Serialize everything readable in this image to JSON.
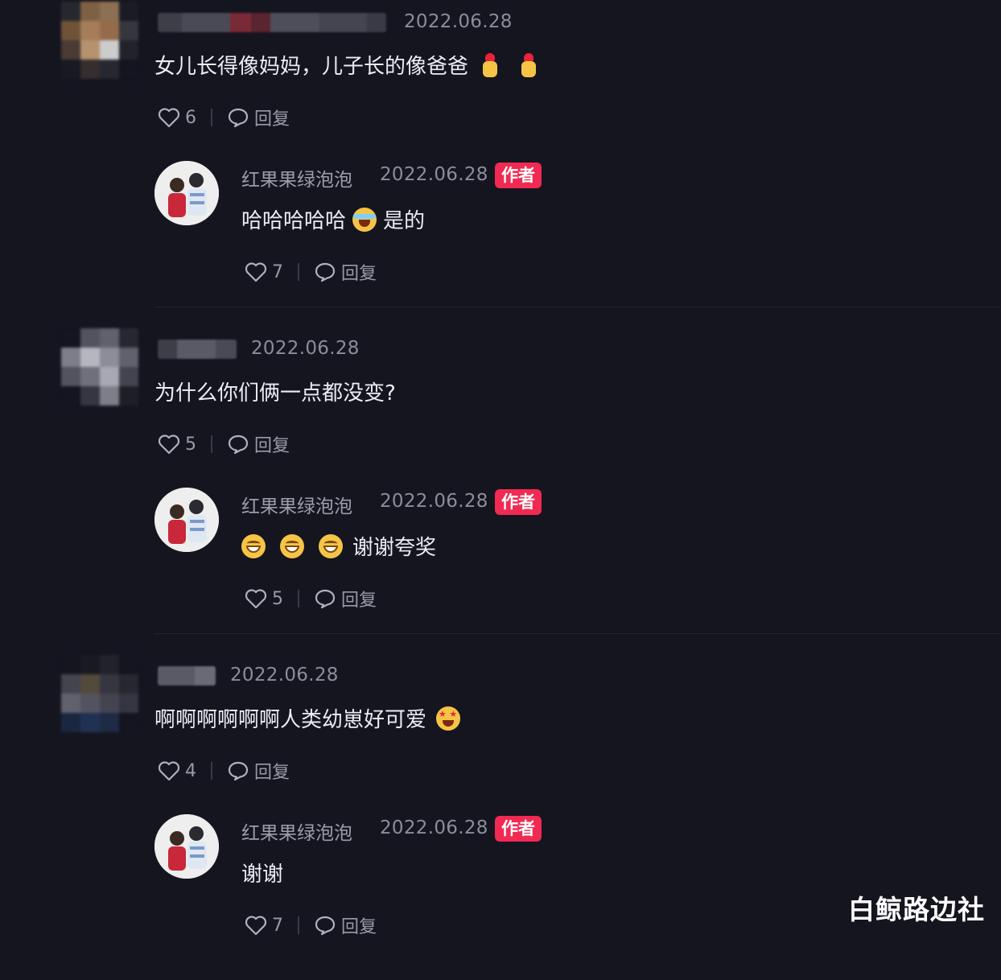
{
  "comments": [
    {
      "date": "2022.06.28",
      "text": "女儿长得像妈妈，儿子长的像爸爸",
      "emojis": [
        "finger-heart-emoji",
        "finger-heart-emoji"
      ],
      "likes": "6",
      "reply_label": "回复",
      "author_reply": {
        "name": "红果果绿泡泡",
        "date": "2022.06.28",
        "badge": "作者",
        "text_before": "哈哈哈哈哈",
        "text_after": "是的",
        "likes": "7",
        "reply_label": "回复"
      }
    },
    {
      "date": "2022.06.28",
      "text": "为什么你们俩一点都没变?",
      "likes": "5",
      "reply_label": "回复",
      "author_reply": {
        "name": "红果果绿泡泡",
        "date": "2022.06.28",
        "badge": "作者",
        "text": "谢谢夸奖",
        "likes": "5",
        "reply_label": "回复"
      }
    },
    {
      "date": "2022.06.28",
      "text": "啊啊啊啊啊啊人类幼崽好可爱",
      "likes": "4",
      "reply_label": "回复",
      "author_reply": {
        "name": "红果果绿泡泡",
        "date": "2022.06.28",
        "badge": "作者",
        "text": "谢谢",
        "likes": "7",
        "reply_label": "回复"
      }
    }
  ],
  "watermark": "白鲸路边社",
  "colors": {
    "background": "#151520",
    "badge": "#f02a52",
    "muted_text": "#8d8d99",
    "text": "#ececf2"
  }
}
